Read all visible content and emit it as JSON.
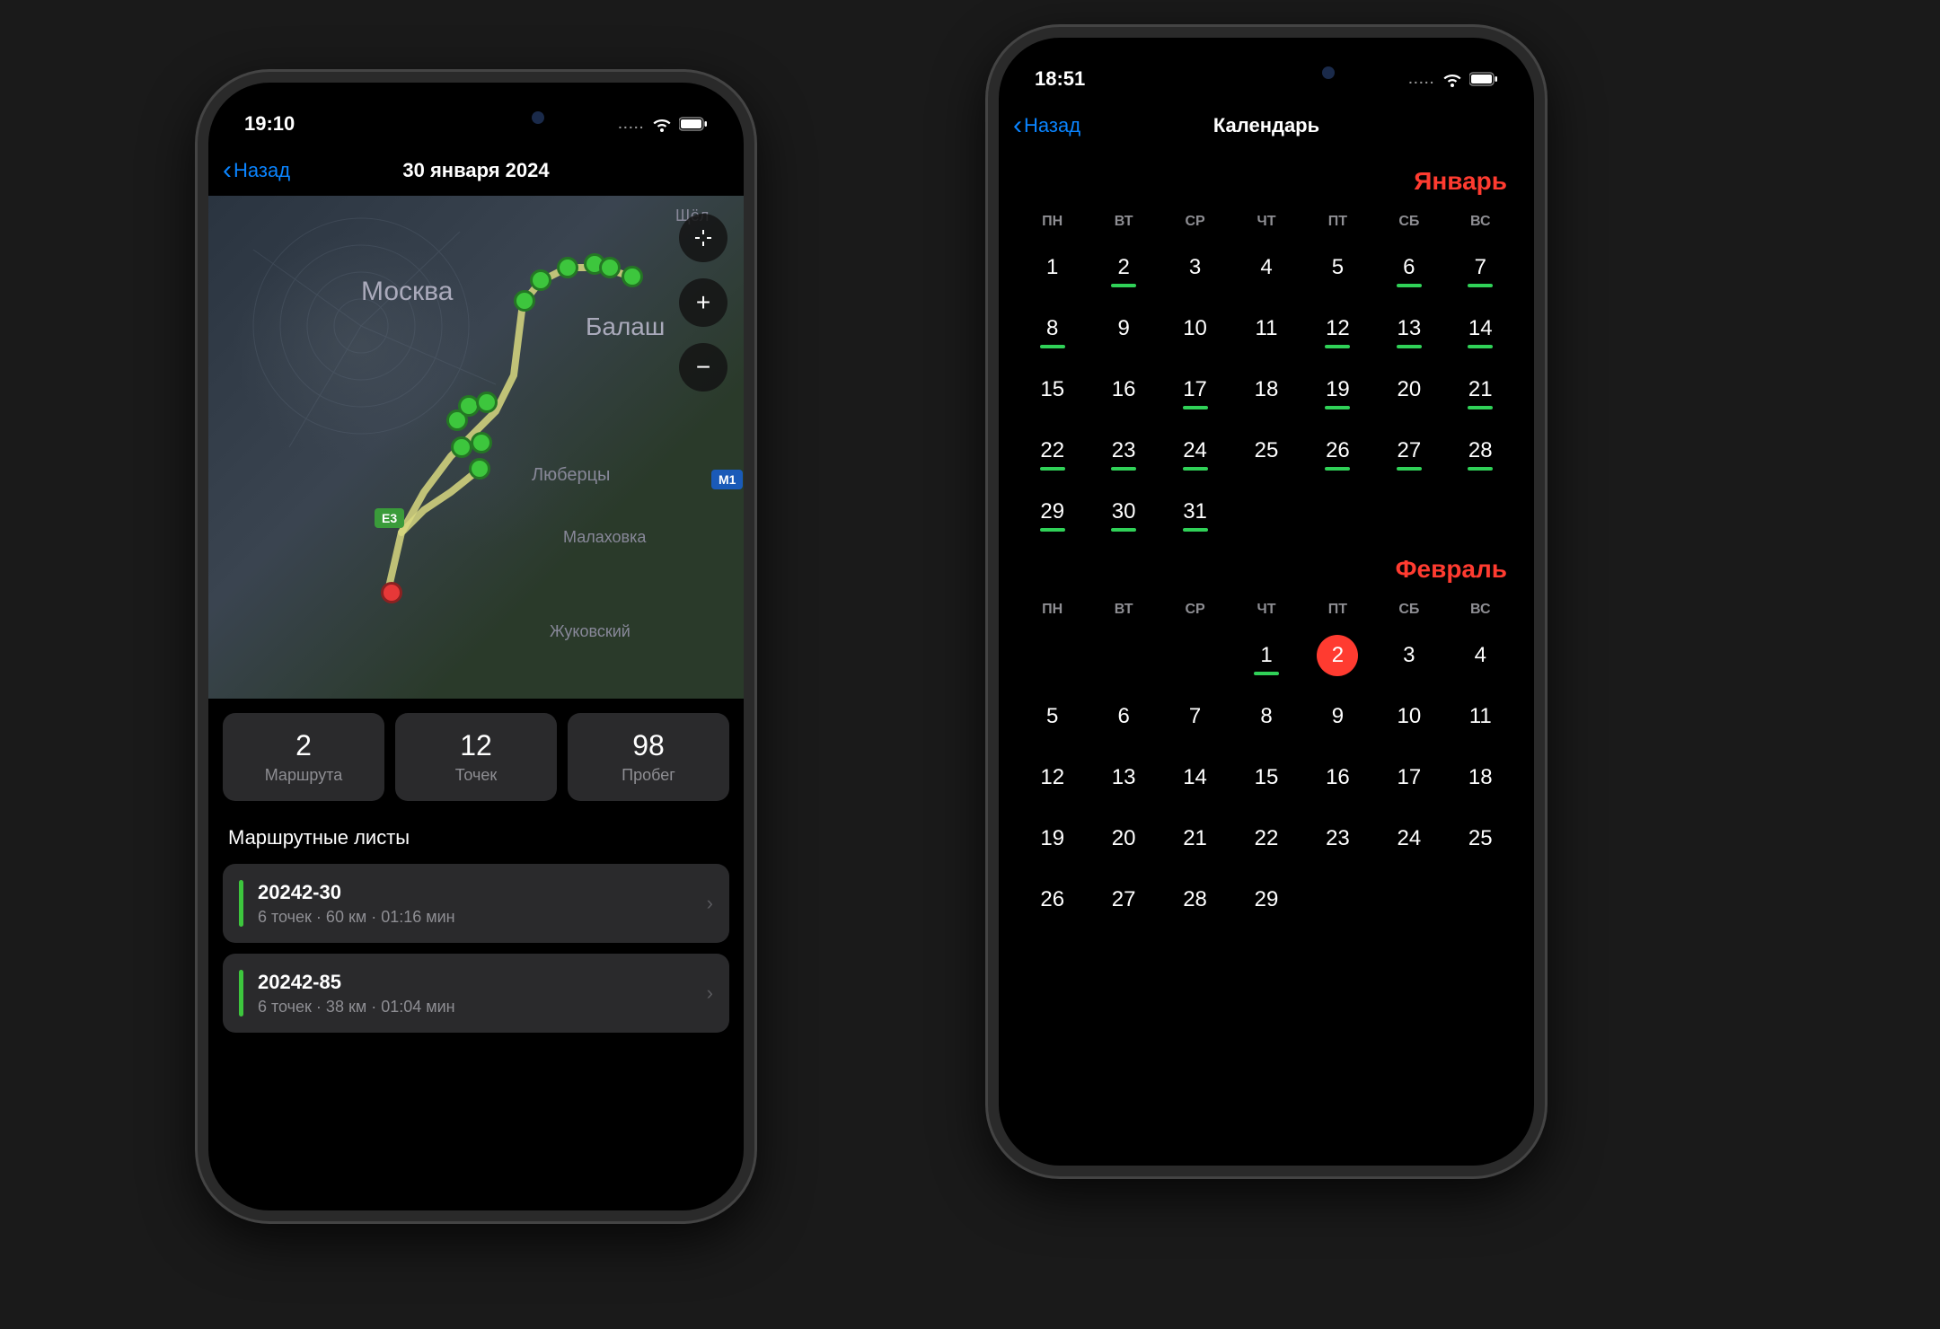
{
  "phone1": {
    "status": {
      "time": "19:10",
      "signal_dots": "....."
    },
    "nav": {
      "back": "Назад",
      "title": "30 января 2024"
    },
    "map": {
      "labels": {
        "moscow": "Москва",
        "balashikha": "Балаш",
        "lyubertsy": "Люберцы",
        "malakhovka": "Малаховка",
        "zhukovsky": "Жуковский",
        "shchel": "Щёл"
      },
      "badges": {
        "e3": "E3",
        "m1": "M1"
      },
      "controls": {
        "center": "⊹",
        "zoom_in": "+",
        "zoom_out": "−"
      }
    },
    "stats": {
      "routes": {
        "value": "2",
        "label": "Маршрута"
      },
      "points": {
        "value": "12",
        "label": "Точек"
      },
      "mileage": {
        "value": "98",
        "label": "Пробег"
      }
    },
    "section_title": "Маршрутные листы",
    "routes": [
      {
        "name": "20242-30",
        "meta": "6 точек · 60 км · 01:16 мин"
      },
      {
        "name": "20242-85",
        "meta": "6 точек · 38 км · 01:04 мин"
      }
    ]
  },
  "phone2": {
    "status": {
      "time": "18:51",
      "signal_dots": "....."
    },
    "nav": {
      "back": "Назад",
      "title": "Календарь"
    },
    "calendar": {
      "weekdays": [
        "ПН",
        "ВТ",
        "СР",
        "ЧТ",
        "ПТ",
        "СБ",
        "ВС"
      ],
      "months": [
        {
          "name": "Январь",
          "offset": 0,
          "days": 31,
          "marked": [
            2,
            6,
            7,
            8,
            12,
            13,
            14,
            17,
            19,
            21,
            22,
            23,
            24,
            26,
            27,
            28,
            29,
            30,
            31
          ],
          "selected": null
        },
        {
          "name": "Февраль",
          "offset": 3,
          "days": 29,
          "marked": [
            1
          ],
          "selected": 2
        }
      ]
    }
  }
}
